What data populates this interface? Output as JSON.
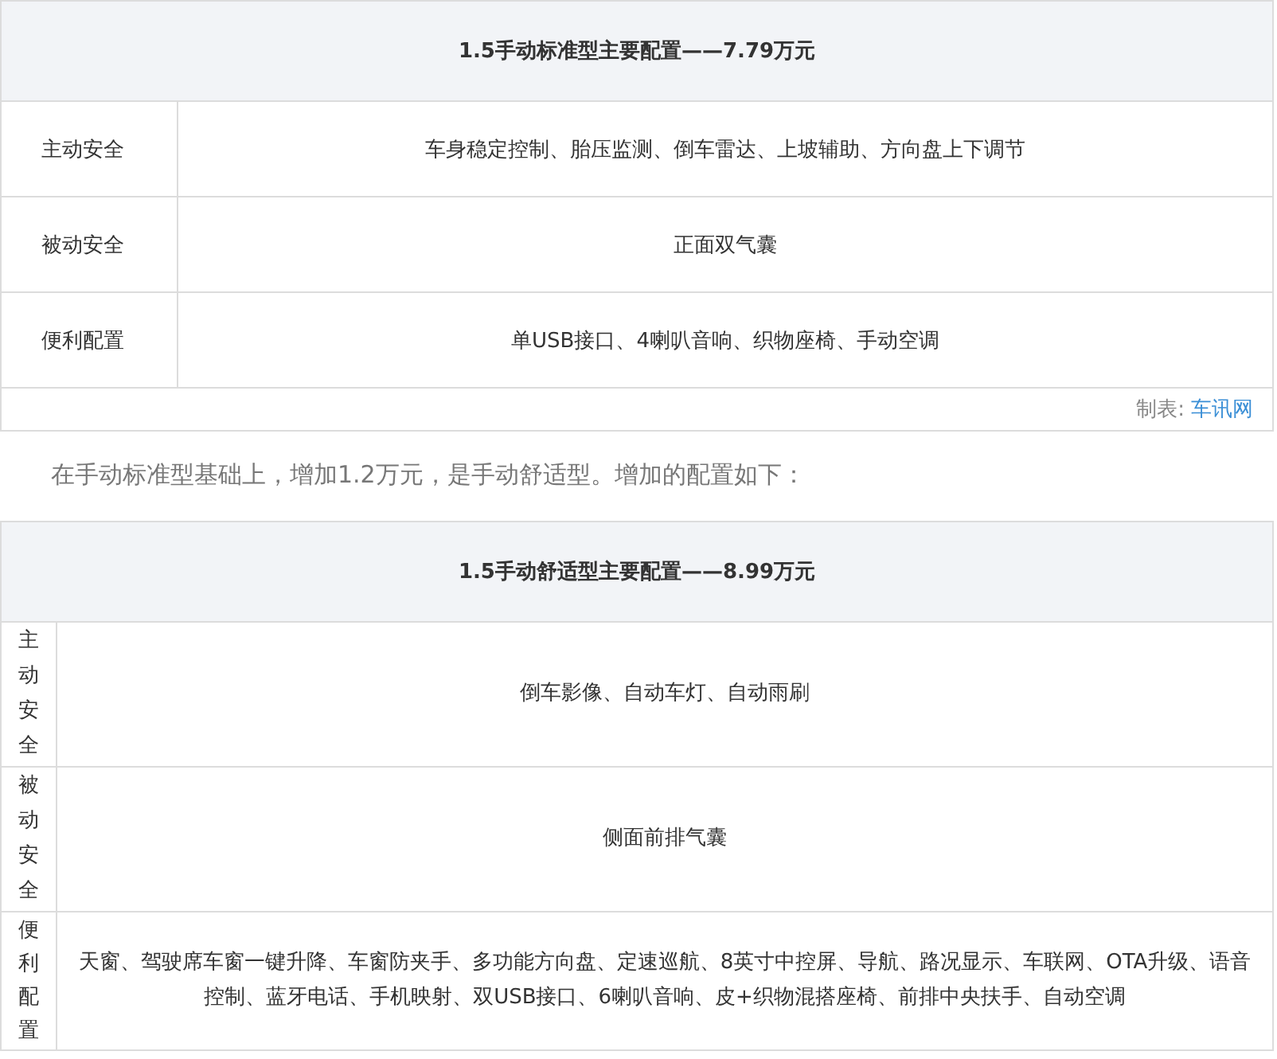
{
  "table_1": {
    "title": "1.5手动标准型主要配置——7.79万元",
    "rows": [
      {
        "label": "主动安全",
        "value": "车身稳定控制、胎压监测、倒车雷达、上坡辅助、方向盘上下调节"
      },
      {
        "label": "被动安全",
        "value": "正面双气囊"
      },
      {
        "label": "便利配置",
        "value": "单USB接口、4喇叭音响、织物座椅、手动空调"
      }
    ],
    "credit": {
      "label": "制表:",
      "source": "车讯网"
    }
  },
  "paragraph": "在手动标准型基础上，增加1.2万元，是手动舒适型。增加的配置如下：",
  "table_2": {
    "title": "1.5手动舒适型主要配置——8.99万元",
    "rows": [
      {
        "label": "主动安全",
        "value": "倒车影像、自动车灯、自动雨刷"
      },
      {
        "label": "被动安全",
        "value": "侧面前排气囊"
      },
      {
        "label": "便利配置",
        "value": "天窗、驾驶席车窗一键升降、车窗防夹手、多功能方向盘、定速巡航、8英寸中控屏、导航、路况显示、车联网、OTA升级、语音控制、蓝牙电话、手机映射、双USB接口、6喇叭音响、皮+织物混搭座椅、前排中央扶手、自动空调"
      }
    ]
  }
}
